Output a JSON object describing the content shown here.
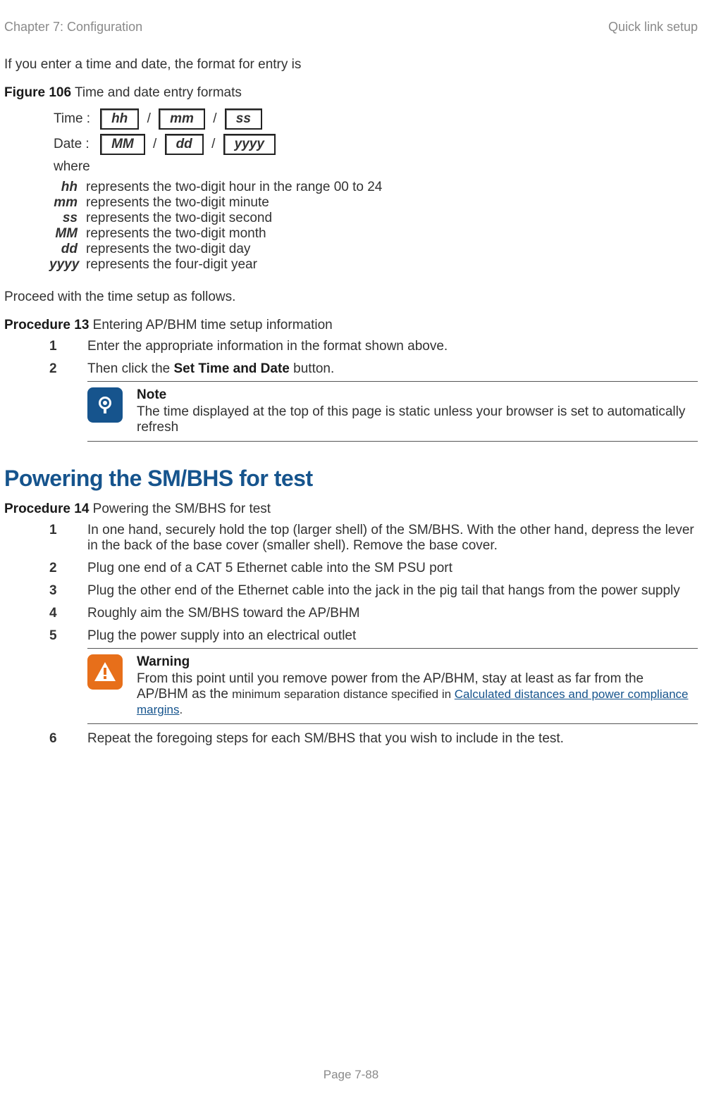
{
  "header": {
    "left": "Chapter 7:  Configuration",
    "right": "Quick link setup"
  },
  "intro": "If you enter a time and date, the format for entry is",
  "figure": {
    "label": "Figure 106",
    "title": " Time and date entry formats"
  },
  "format": {
    "time_label": "Time :",
    "date_label": "Date :",
    "where_label": "where",
    "sep": "/",
    "time": {
      "b1": "hh",
      "b2": "mm",
      "b3": "ss"
    },
    "date": {
      "b1": "MM",
      "b2": "dd",
      "b3": "yyyy"
    },
    "defs": [
      {
        "k": "hh",
        "v": "represents the two-digit hour in the range 00 to 24"
      },
      {
        "k": "mm",
        "v": "represents the two-digit minute"
      },
      {
        "k": "ss",
        "v": "represents the two-digit second"
      },
      {
        "k": "MM",
        "v": "represents the two-digit month"
      },
      {
        "k": "dd",
        "v": "represents the two-digit day"
      },
      {
        "k": "yyyy",
        "v": "represents the four-digit year"
      }
    ]
  },
  "proceed": "Proceed with the time setup as follows.",
  "proc13": {
    "label": "Procedure 13",
    "title": " Entering AP/BHM time setup information",
    "steps": {
      "s1": "Enter the appropriate information in the format shown above.",
      "s2_pre": "Then click the ",
      "s2_btn": "Set Time and Date",
      "s2_post": " button."
    },
    "note": {
      "title": "Note",
      "body": "The time displayed at the top of this page is static unless your browser is set to automatically refresh"
    }
  },
  "section_h2": "Powering the SM/BHS for test",
  "proc14": {
    "label": "Procedure 14",
    "title": " Powering the SM/BHS for test",
    "steps": {
      "s1": "In one hand, securely hold the top (larger shell) of the SM/BHS. With the other hand, depress the lever in the back of the base cover (smaller shell). Remove the base cover.",
      "s2": "Plug one end of a CAT 5 Ethernet cable into the SM PSU port",
      "s3": "Plug the other end of the Ethernet cable into the jack in the pig tail that hangs from the power supply",
      "s4": "Roughly aim the SM/BHS toward the AP/BHM",
      "s5": "Plug the power supply into an electrical outlet",
      "s6": "Repeat the foregoing steps for each SM/BHS that you wish to include in the test."
    },
    "warning": {
      "title": "Warning",
      "body_pre": "From this point until you remove power from the AP/BHM, stay at least as far from the AP/BHM as the ",
      "body_small": "minimum separation distance specified in ",
      "link": "Calculated distances and power compliance margins",
      "body_post": "."
    }
  },
  "nums": {
    "n1": "1",
    "n2": "2",
    "n3": "3",
    "n4": "4",
    "n5": "5",
    "n6": "6"
  },
  "footer": "Page 7-88"
}
